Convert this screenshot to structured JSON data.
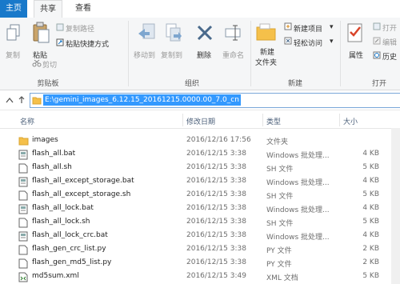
{
  "tabs": {
    "file": "主页",
    "home": "共享",
    "view": "查看"
  },
  "ribbon": {
    "copy": "复制",
    "paste": "粘贴",
    "copy_path": "复制路径",
    "paste_shortcut": "粘贴快捷方式",
    "cut": "剪切",
    "clipboard": "剪贴板",
    "move_to": "移动到",
    "copy_to": "复制到",
    "delete": "删除",
    "rename": "重命名",
    "organize": "组织",
    "new_folder_line1": "新建",
    "new_folder_line2": "文件夹",
    "new_item": "新建项目",
    "easy_access": "轻松访问",
    "new": "新建",
    "properties": "属性",
    "open_item": "打开",
    "edit": "编辑",
    "history": "历史",
    "open": "打开"
  },
  "address": {
    "path": "E:\\gemini_images_6.12.15_20161215.0000.00_7.0_cn"
  },
  "columns": {
    "name": "名称",
    "date": "修改日期",
    "type": "类型",
    "size": "大小"
  },
  "files": [
    {
      "name": "images",
      "date": "2016/12/16 17:56",
      "type": "文件夹",
      "size": "",
      "icon": "folder-icon"
    },
    {
      "name": "flash_all.bat",
      "date": "2016/12/15 3:38",
      "type": "Windows 批处理...",
      "size": "4 KB",
      "icon": "bat-file-icon"
    },
    {
      "name": "flash_all.sh",
      "date": "2016/12/15 3:38",
      "type": "SH 文件",
      "size": "5 KB",
      "icon": "file-icon"
    },
    {
      "name": "flash_all_except_storage.bat",
      "date": "2016/12/15 3:38",
      "type": "Windows 批处理...",
      "size": "4 KB",
      "icon": "bat-file-icon"
    },
    {
      "name": "flash_all_except_storage.sh",
      "date": "2016/12/15 3:38",
      "type": "SH 文件",
      "size": "5 KB",
      "icon": "file-icon"
    },
    {
      "name": "flash_all_lock.bat",
      "date": "2016/12/15 3:38",
      "type": "Windows 批处理...",
      "size": "4 KB",
      "icon": "bat-file-icon"
    },
    {
      "name": "flash_all_lock.sh",
      "date": "2016/12/15 3:38",
      "type": "SH 文件",
      "size": "5 KB",
      "icon": "file-icon"
    },
    {
      "name": "flash_all_lock_crc.bat",
      "date": "2016/12/15 3:38",
      "type": "Windows 批处理...",
      "size": "4 KB",
      "icon": "bat-file-icon"
    },
    {
      "name": "flash_gen_crc_list.py",
      "date": "2016/12/15 3:38",
      "type": "PY 文件",
      "size": "2 KB",
      "icon": "file-icon"
    },
    {
      "name": "flash_gen_md5_list.py",
      "date": "2016/12/15 3:38",
      "type": "PY 文件",
      "size": "2 KB",
      "icon": "file-icon"
    },
    {
      "name": "md5sum.xml",
      "date": "2016/12/15 3:49",
      "type": "XML 文档",
      "size": "5 KB",
      "icon": "xml-file-icon"
    }
  ],
  "colors": {
    "accent": "#1979ca",
    "selection": "#3399ff",
    "folder": "#f5c04a"
  }
}
